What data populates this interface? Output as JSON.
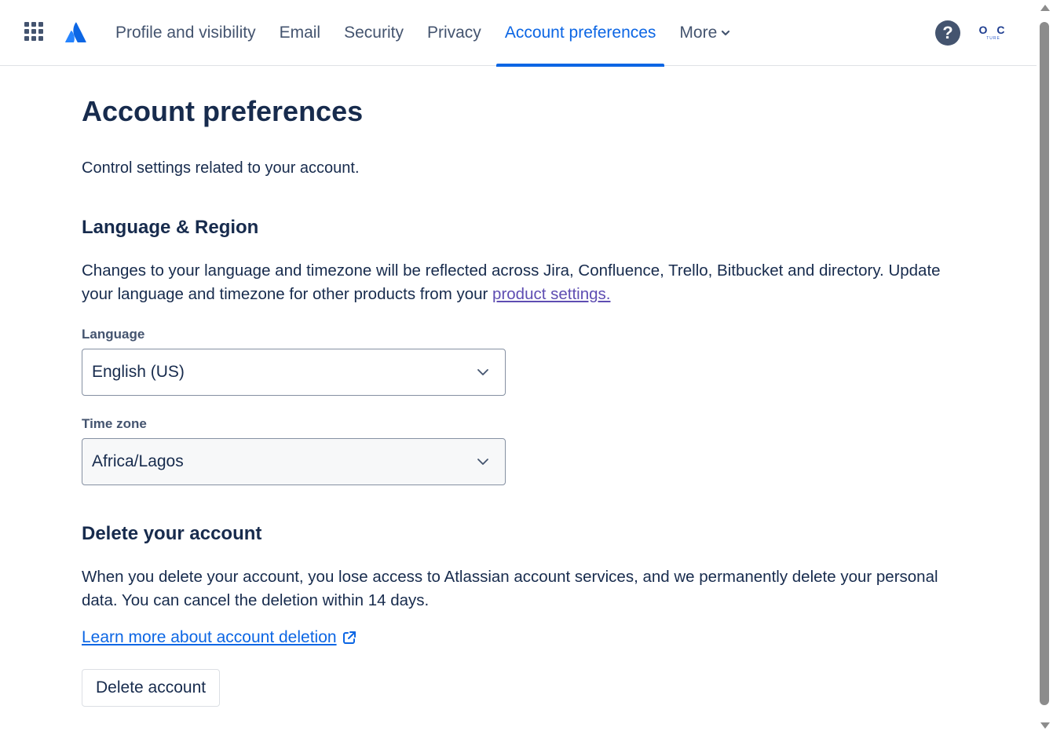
{
  "header": {
    "nav": {
      "tabs": [
        {
          "label": "Profile and visibility"
        },
        {
          "label": "Email"
        },
        {
          "label": "Security"
        },
        {
          "label": "Privacy"
        },
        {
          "label": "Account preferences",
          "active": true
        },
        {
          "label": "More"
        }
      ]
    },
    "help_icon_glyph": "?",
    "avatar": {
      "initials": "O C",
      "subtext": "TURE"
    },
    "icons": {
      "app_switcher": "grid-icon",
      "logo": "atlassian-logo-icon",
      "help": "help-icon",
      "more_chevron": "chevron-down-icon"
    }
  },
  "main": {
    "title": "Account preferences",
    "description": "Control settings related to your account.",
    "language_region": {
      "title": "Language & Region",
      "body": "Changes to your language and timezone will be reflected across Jira, Confluence, Trello, Bitbucket and directory. Update your language and timezone for other products from your ",
      "link_text": "product settings.",
      "language_label": "Language",
      "language_value": "English (US)",
      "timezone_label": "Time zone",
      "timezone_value": "Africa/Lagos"
    },
    "delete_account": {
      "title": "Delete your account",
      "body": "When you delete your account, you lose access to Atlassian account services, and we permanently delete your personal data. You can cancel the deletion within 14 days.",
      "learn_more": "Learn more about account deletion",
      "button_label": "Delete account"
    }
  },
  "colors": {
    "accent": "#0c66e4",
    "text": "#172b4d",
    "subtle_text": "#44546f",
    "visited_link": "#5e4db2"
  }
}
